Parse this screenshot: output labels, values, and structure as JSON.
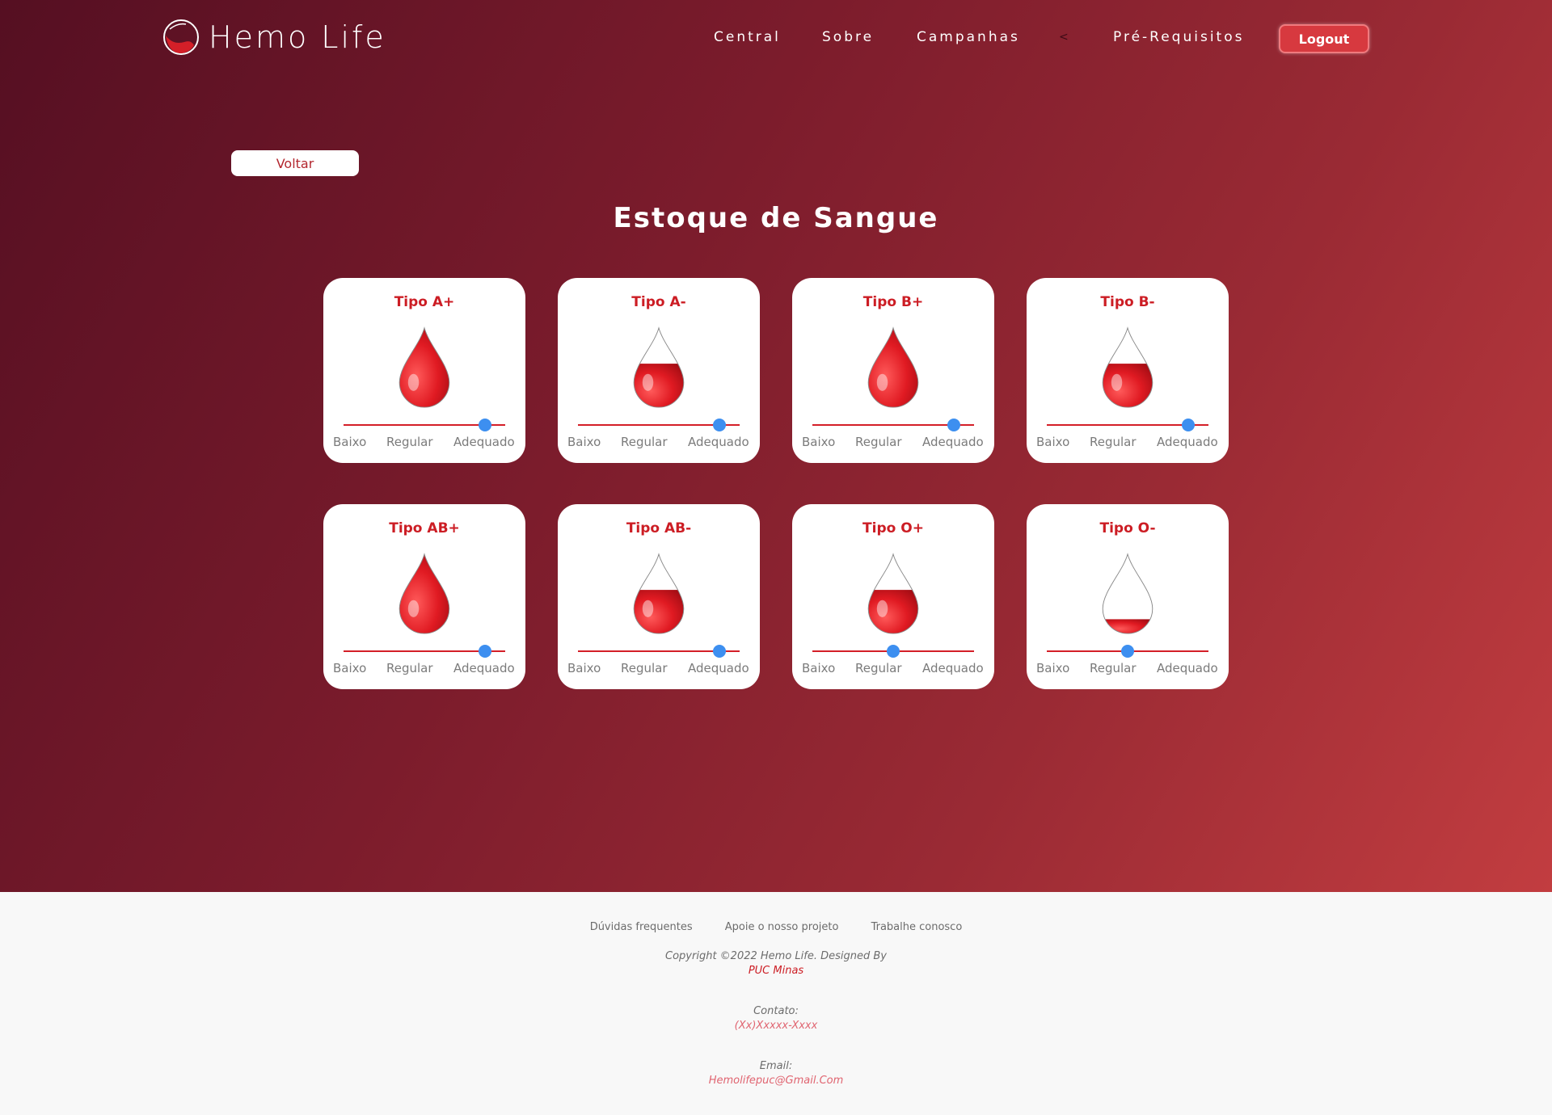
{
  "brand": {
    "name": "Hemo Life"
  },
  "nav": {
    "items": [
      "Central",
      "Sobre",
      "Campanhas",
      "Pré-Requisitos"
    ],
    "caret": "<",
    "logout": "Logout"
  },
  "back_label": "Voltar",
  "page_title": "Estoque de Sangue",
  "level_labels": [
    "Baixo",
    "Regular",
    "Adequado"
  ],
  "colors": {
    "blood": "#d41f28",
    "knob": "#3d8ff0",
    "title_red": "#cc1d24"
  },
  "blood_types": [
    {
      "label": "Tipo A+",
      "fill": 1.0,
      "level": "Adequado"
    },
    {
      "label": "Tipo A-",
      "fill": 0.55,
      "level": "Adequado"
    },
    {
      "label": "Tipo B+",
      "fill": 1.0,
      "level": "Adequado"
    },
    {
      "label": "Tipo B-",
      "fill": 0.55,
      "level": "Adequado"
    },
    {
      "label": "Tipo AB+",
      "fill": 1.0,
      "level": "Adequado"
    },
    {
      "label": "Tipo AB-",
      "fill": 0.55,
      "level": "Adequado"
    },
    {
      "label": "Tipo O+",
      "fill": 0.55,
      "level": "Regular"
    },
    {
      "label": "Tipo O-",
      "fill": 0.18,
      "level": "Regular"
    }
  ],
  "footer": {
    "links": [
      "Dúvidas frequentes",
      "Apoie o nosso projeto",
      "Trabalhe conosco"
    ],
    "copyright": "Copyright ©2022 Hemo Life. Designed By",
    "designer": "PUC Minas",
    "contact_label": "Contato:",
    "contact_value": "(Xx)Xxxxx-Xxxx",
    "email_label": "Email:",
    "email_value": "Hemolifepuc@Gmail.Com"
  }
}
